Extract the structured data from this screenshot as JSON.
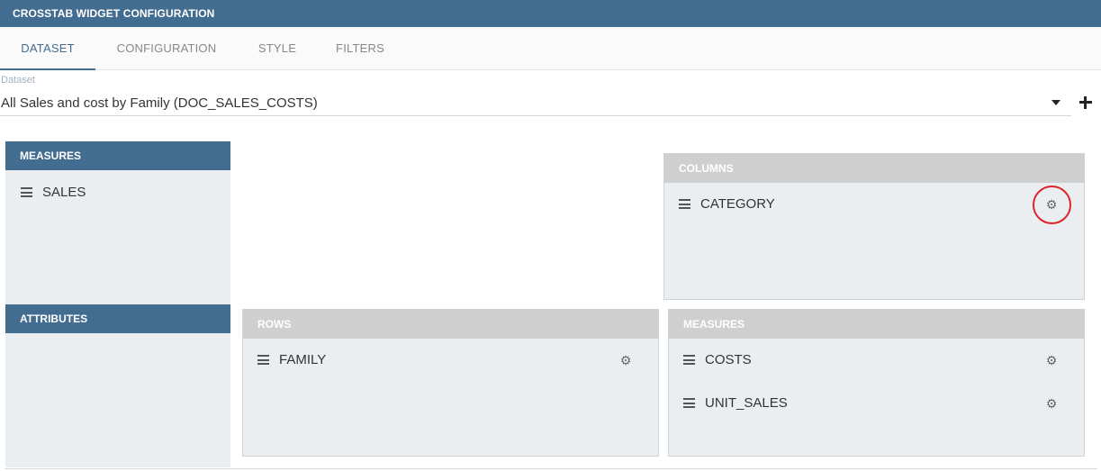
{
  "header": {
    "title": "CROSSTAB WIDGET CONFIGURATION"
  },
  "tabs": [
    {
      "label": "DATASET",
      "active": true
    },
    {
      "label": "CONFIGURATION",
      "active": false
    },
    {
      "label": "STYLE",
      "active": false
    },
    {
      "label": "FILTERS",
      "active": false
    }
  ],
  "dataset": {
    "label": "Dataset",
    "value": "All Sales and cost by Family (DOC_SALES_COSTS)"
  },
  "sidebar": {
    "measures": {
      "title": "MEASURES",
      "items": [
        "SALES"
      ]
    },
    "attributes": {
      "title": "ATTRIBUTES",
      "items": []
    }
  },
  "columns": {
    "title": "COLUMNS",
    "items": [
      "CATEGORY"
    ]
  },
  "rows": {
    "title": "ROWS",
    "items": [
      "FAMILY"
    ]
  },
  "measures": {
    "title": "MEASURES",
    "items": [
      "COSTS",
      "UNIT_SALES"
    ]
  },
  "icons": {
    "drag": "drag-handle-icon",
    "settings": "gear-icon",
    "add": "plus-icon",
    "dropdown": "caret-down-icon"
  },
  "colors": {
    "accent": "#436d90",
    "panel_header": "#cfcfcf",
    "panel_bg": "#ebeef1",
    "highlight": "#d9262b"
  }
}
